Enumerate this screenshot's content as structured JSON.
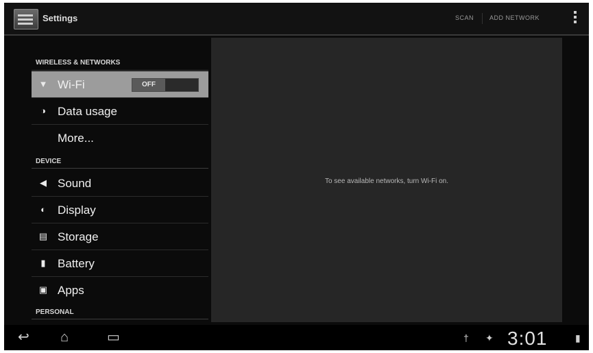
{
  "actionbar": {
    "title": "Settings",
    "scan_label": "SCAN",
    "add_network_label": "ADD NETWORK"
  },
  "sections": {
    "wireless": {
      "header": "WIRELESS & NETWORKS",
      "items": [
        {
          "label": "Wi-Fi",
          "icon": "wifi-icon",
          "toggle": "OFF"
        },
        {
          "label": "Data usage",
          "icon": "data-usage-icon"
        },
        {
          "label": "More..."
        }
      ]
    },
    "device": {
      "header": "DEVICE",
      "items": [
        {
          "label": "Sound",
          "icon": "speaker-icon"
        },
        {
          "label": "Display",
          "icon": "display-icon"
        },
        {
          "label": "Storage",
          "icon": "storage-icon"
        },
        {
          "label": "Battery",
          "icon": "battery-icon"
        },
        {
          "label": "Apps",
          "icon": "apps-icon"
        }
      ]
    },
    "personal": {
      "header": "PERSONAL"
    }
  },
  "detail": {
    "message": "To see available networks, turn Wi-Fi on."
  },
  "statusbar": {
    "time": "3:01"
  },
  "colors": {
    "selected_bg": "#9c9c9c",
    "pane_bg": "#262626",
    "screen_bg": "#0b0b0b"
  }
}
